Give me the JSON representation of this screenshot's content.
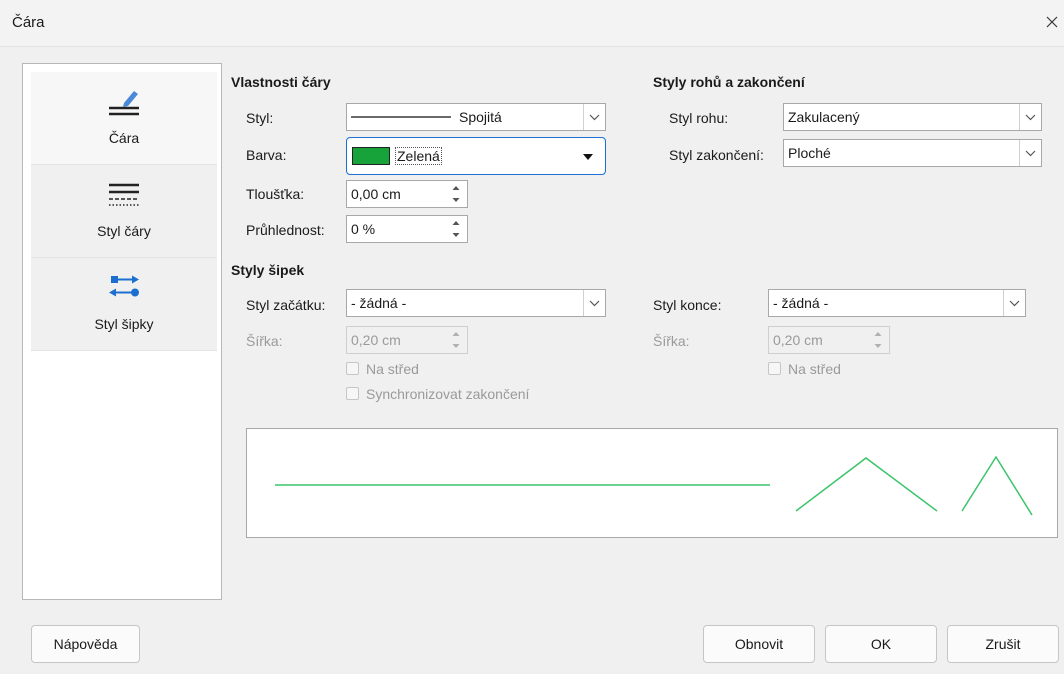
{
  "window": {
    "title": "Čára"
  },
  "sidebar": {
    "items": [
      {
        "label": "Čára",
        "icon": "line-pencil-icon"
      },
      {
        "label": "Styl čáry",
        "icon": "line-style-icon"
      },
      {
        "label": "Styl šipky",
        "icon": "arrow-style-icon"
      }
    ]
  },
  "line_properties": {
    "title": "Vlastnosti čáry",
    "style_label": "Styl:",
    "style_value": "Spojitá",
    "color_label": "Barva:",
    "color_value": "Zelená",
    "color_swatch": "#18a33a",
    "width_label": "Tloušťka:",
    "width_value": "0,00 cm",
    "transparency_label": "Průhlednost:",
    "transparency_value": "0 %"
  },
  "corner_styles": {
    "title": "Styly rohů a zakončení",
    "corner_label": "Styl rohu:",
    "corner_value": "Zakulacený",
    "cap_label": "Styl zakončení:",
    "cap_value": "Ploché"
  },
  "arrow_styles": {
    "title": "Styly šipek",
    "start_label": "Styl začátku:",
    "start_value": "- žádná -",
    "end_label": "Styl konce:",
    "end_value": "- žádná -",
    "start_width_label": "Šířka:",
    "start_width_value": "0,20 cm",
    "end_width_label": "Šířka:",
    "end_width_value": "0,20 cm",
    "start_center_label": "Na střed",
    "end_center_label": "Na střed",
    "sync_label": "Synchronizovat zakončení"
  },
  "preview": {
    "line_color": "#3cc46a"
  },
  "buttons": {
    "help": "Nápověda",
    "reset": "Obnovit",
    "ok": "OK",
    "cancel": "Zrušit"
  }
}
